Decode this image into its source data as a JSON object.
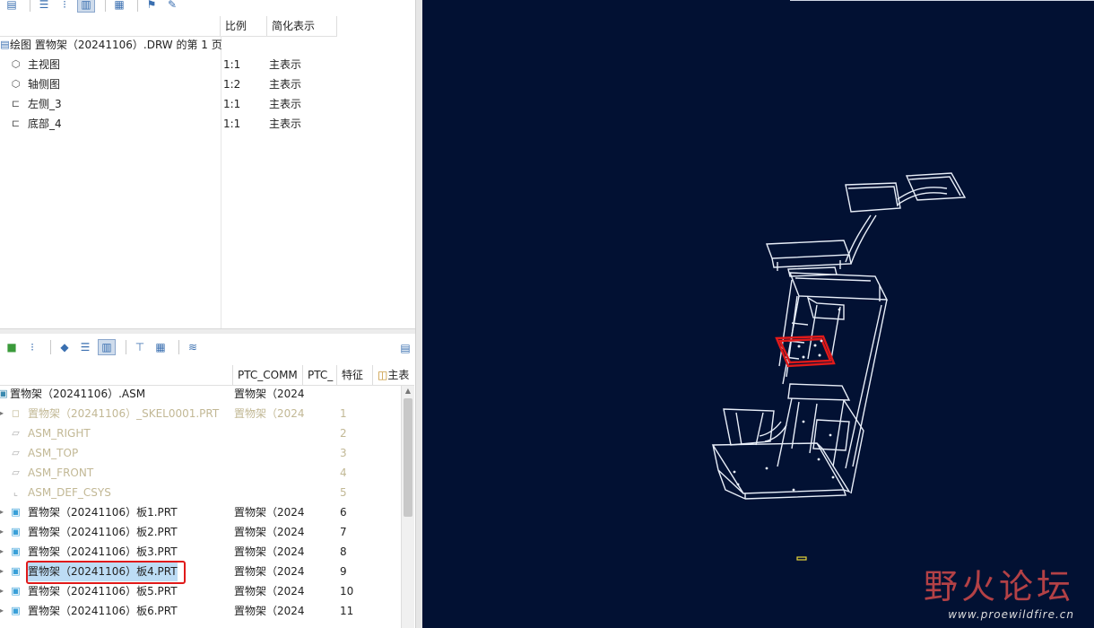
{
  "drawing_tree": {
    "columns": [
      "比例",
      "简化表示"
    ],
    "root": "绘图 置物架（20241106）.DRW 的第 1 页",
    "views": [
      {
        "name": "主视图",
        "scale": "1:1",
        "rep": "主表示",
        "icon": "view-icon"
      },
      {
        "name": "轴侧图",
        "scale": "1:2",
        "rep": "主表示",
        "icon": "view-icon"
      },
      {
        "name": "左侧_3",
        "scale": "1:1",
        "rep": "主表示",
        "icon": "projection-view-icon"
      },
      {
        "name": "底部_4",
        "scale": "1:1",
        "rep": "主表示",
        "icon": "projection-view-icon"
      }
    ]
  },
  "model_tree": {
    "columns": [
      "PTC_COMM",
      "PTC_",
      "特征",
      "主表"
    ],
    "root": {
      "name": "置物架（20241106）.ASM",
      "comm": "置物架（2024"
    },
    "items": [
      {
        "name": "置物架（20241106）_SKEL0001.PRT",
        "comm": "置物架（2024",
        "num": "1",
        "dim": true,
        "icon": "skeleton-icon",
        "expand": true
      },
      {
        "name": "ASM_RIGHT",
        "comm": "",
        "num": "2",
        "dim": true,
        "icon": "datum-plane-icon",
        "expand": false
      },
      {
        "name": "ASM_TOP",
        "comm": "",
        "num": "3",
        "dim": true,
        "icon": "datum-plane-icon",
        "expand": false
      },
      {
        "name": "ASM_FRONT",
        "comm": "",
        "num": "4",
        "dim": true,
        "icon": "datum-plane-icon",
        "expand": false
      },
      {
        "name": "ASM_DEF_CSYS",
        "comm": "",
        "num": "5",
        "dim": true,
        "icon": "csys-icon",
        "expand": false
      },
      {
        "name": "置物架（20241106）板1.PRT",
        "comm": "置物架（2024",
        "num": "6",
        "dim": false,
        "icon": "part-icon",
        "expand": true
      },
      {
        "name": "置物架（20241106）板2.PRT",
        "comm": "置物架（2024",
        "num": "7",
        "dim": false,
        "icon": "part-icon",
        "expand": true
      },
      {
        "name": "置物架（20241106）板3.PRT",
        "comm": "置物架（2024",
        "num": "8",
        "dim": false,
        "icon": "part-icon",
        "expand": true
      },
      {
        "name": "置物架（20241106）板4.PRT",
        "comm": "置物架（2024",
        "num": "9",
        "dim": false,
        "icon": "part-icon",
        "expand": true,
        "selected": true
      },
      {
        "name": "置物架（20241106）板5.PRT",
        "comm": "置物架（2024",
        "num": "10",
        "dim": false,
        "icon": "part-icon",
        "expand": true
      },
      {
        "name": "置物架（20241106）板6.PRT",
        "comm": "置物架（2024",
        "num": "11",
        "dim": false,
        "icon": "part-icon",
        "expand": true
      }
    ]
  },
  "watermark": {
    "cn": "野火论坛",
    "en": "www.proewildfire.cn"
  },
  "colors": {
    "viewport_bg": "#021133",
    "highlight_red": "#e01a1a",
    "selection": "#bddcf5"
  }
}
